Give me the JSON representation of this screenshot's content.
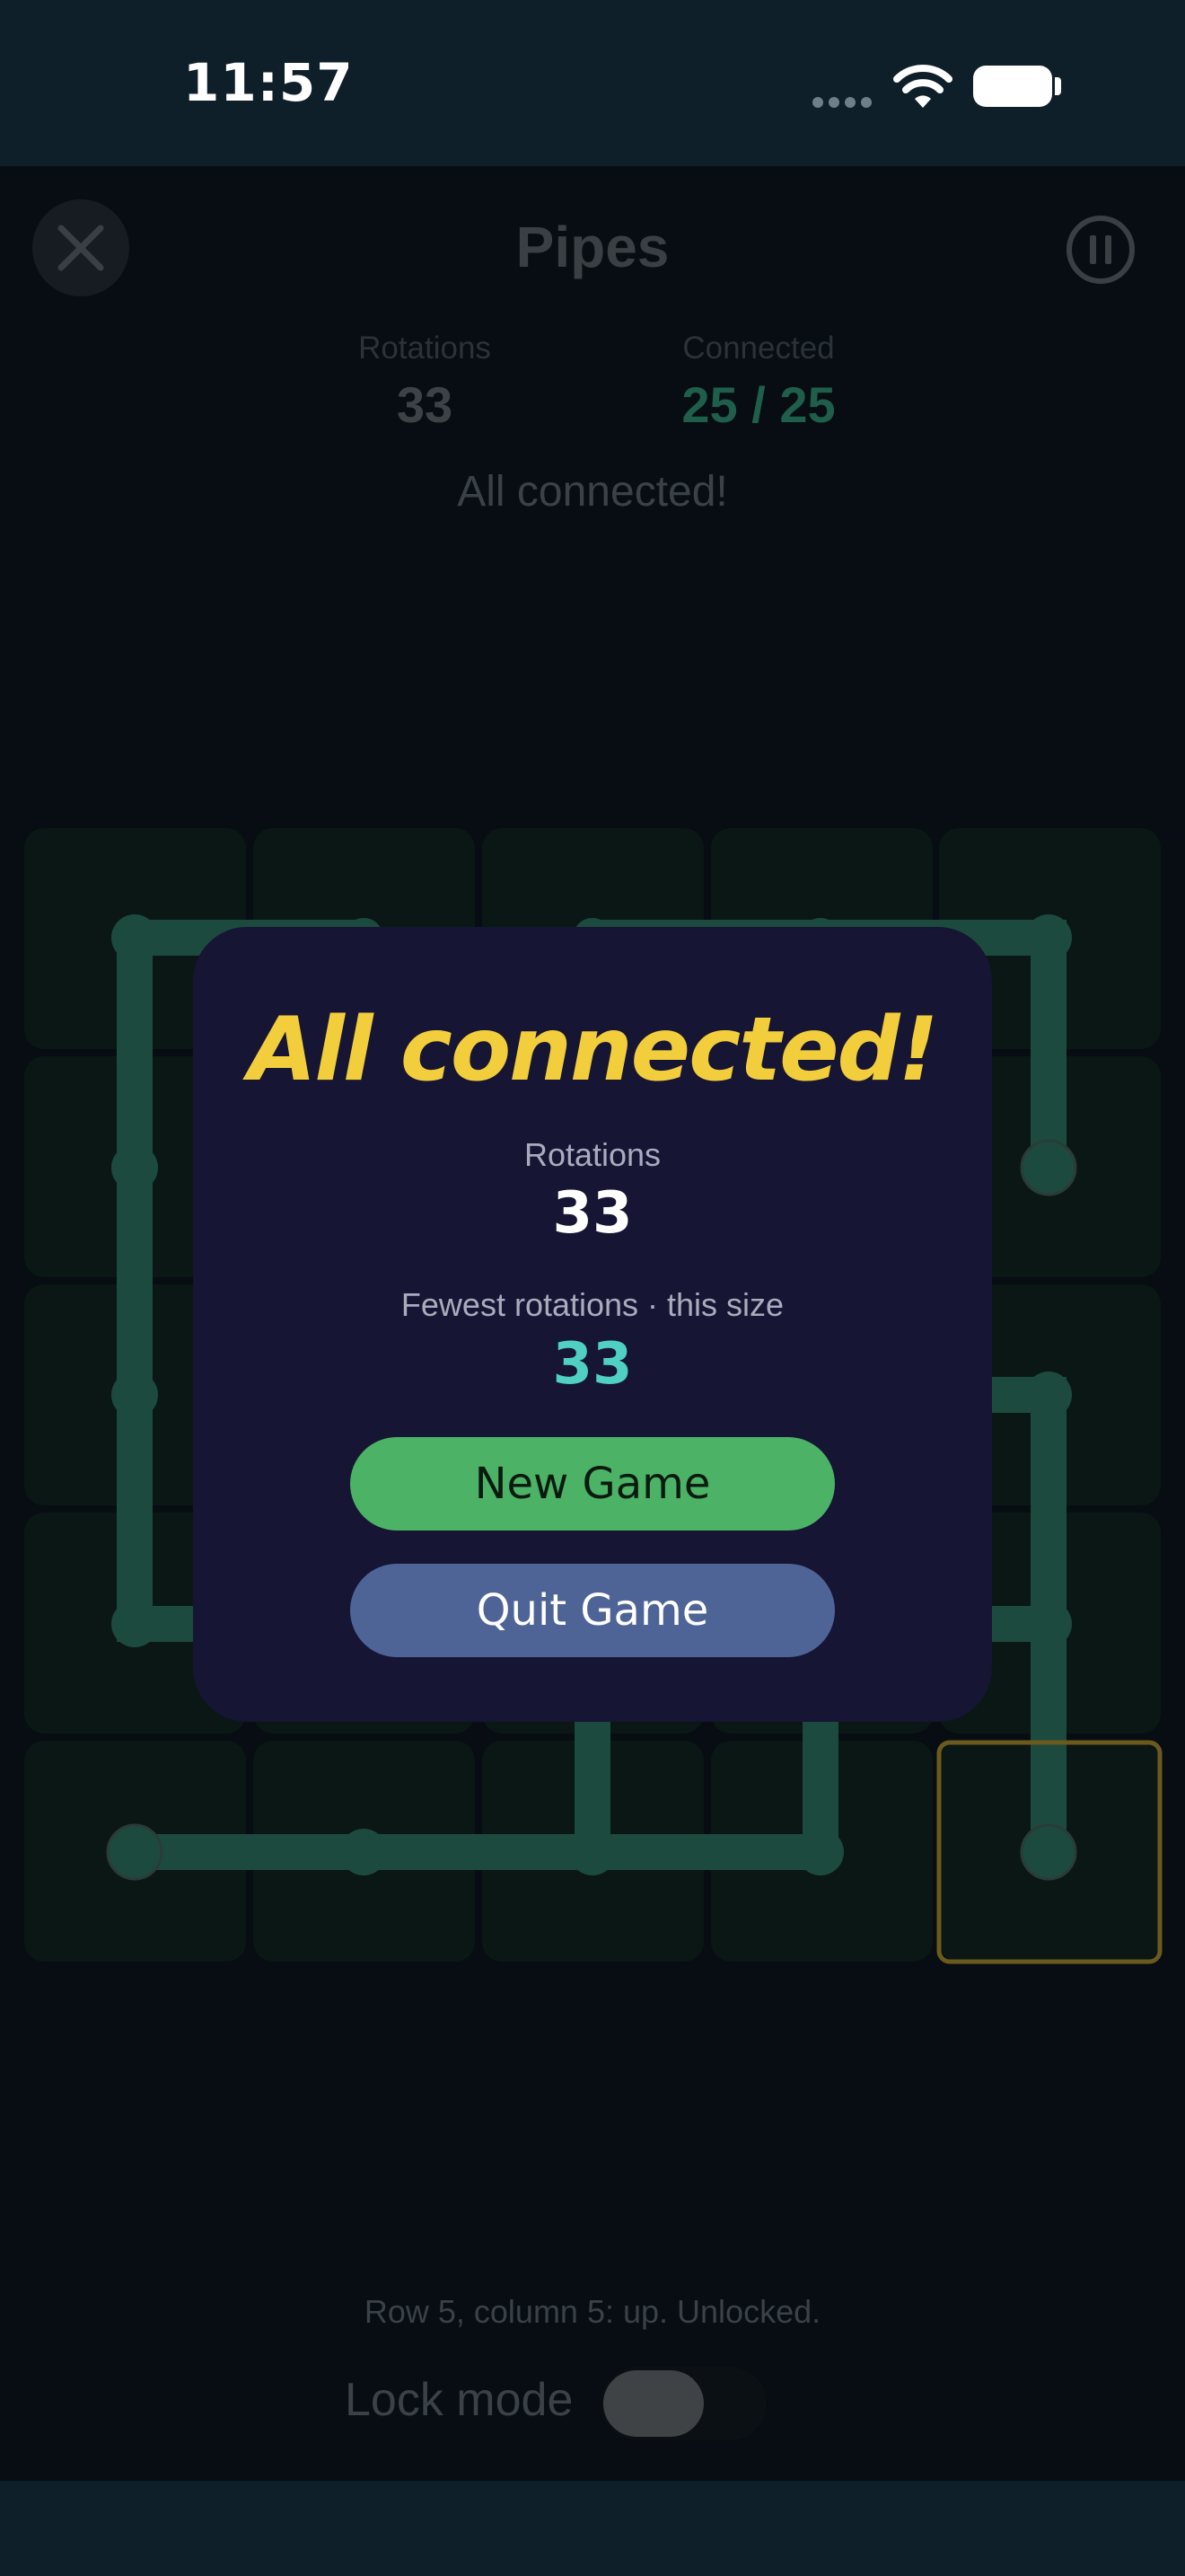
{
  "status_bar": {
    "time": "11:57"
  },
  "header": {
    "title": "Pipes"
  },
  "stats": {
    "rotations_label": "Rotations",
    "rotations_value": "33",
    "connected_label": "Connected",
    "connected_value": "25 / 25"
  },
  "status_message": "All connected!",
  "result_dialog": {
    "title": "All connected!",
    "rotations_label": "Rotations",
    "rotations_value": "33",
    "best_label": "Fewest rotations · this size",
    "best_value": "33",
    "new_game_label": "New Game",
    "quit_game_label": "Quit Game"
  },
  "cell_status": "Row 5, column 5: up. Unlocked.",
  "lock_mode": {
    "label": "Lock mode",
    "enabled": false
  },
  "colors": {
    "pipe": "#1d4a3e",
    "title_yellow": "#f2cd3c",
    "best_cyan": "#4fd0c2",
    "connected_green": "#1f5e4a",
    "selected_cell_border": "#6b5a1d"
  }
}
